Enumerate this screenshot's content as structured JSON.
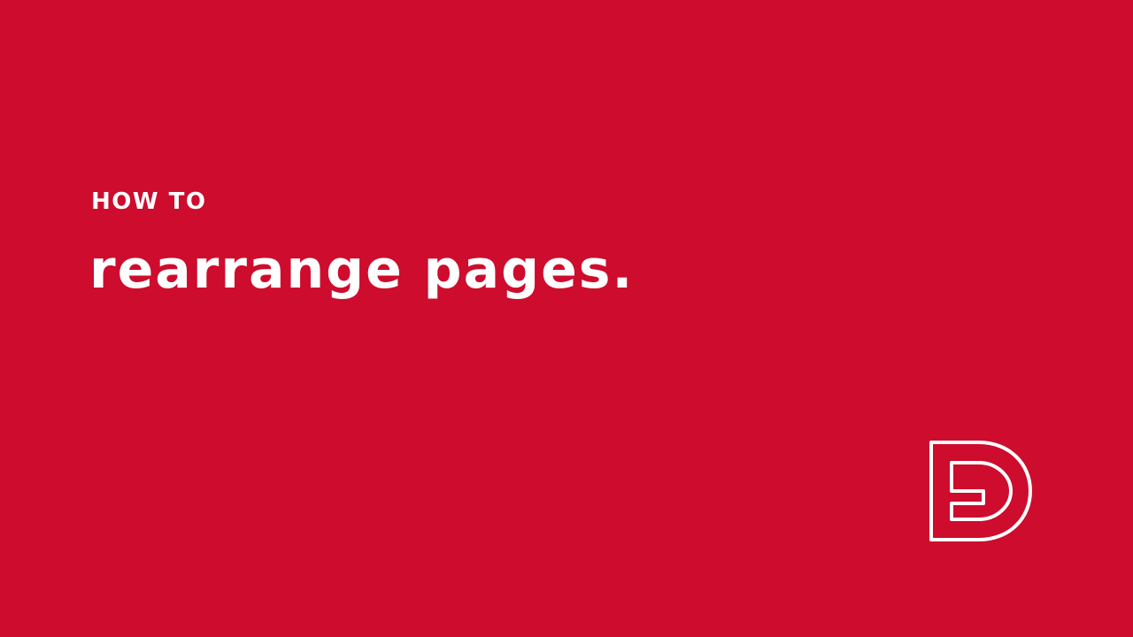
{
  "background_color": "#CE0C2D",
  "text_color": "#FFFFFF",
  "title_slide": {
    "eyebrow": "HOW TO",
    "headline": "rearrange pages."
  },
  "logo": {
    "icon": "outlined-d-e-monogram-logo"
  }
}
